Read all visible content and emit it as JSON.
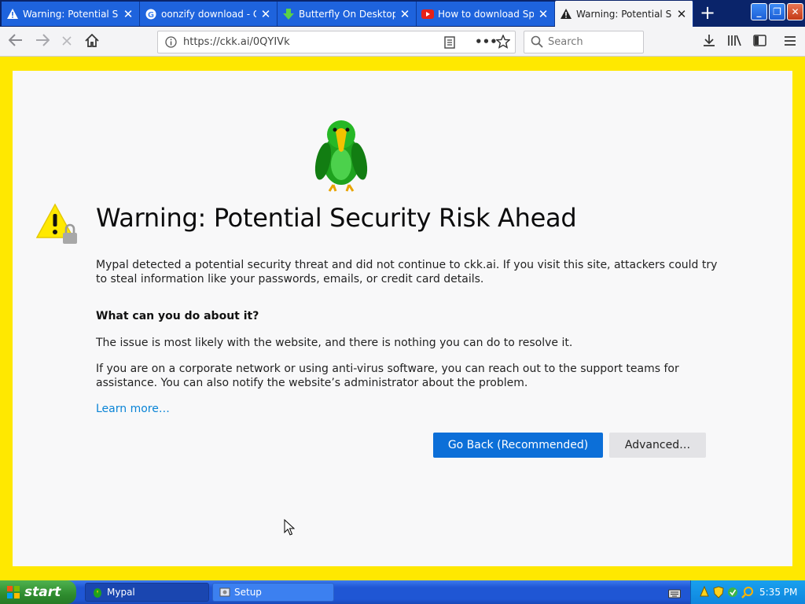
{
  "tabs": [
    {
      "title": "Warning: Potential Secu",
      "icon": "warning-icon",
      "active": false
    },
    {
      "title": "oonzify download - Goo",
      "icon": "google-icon",
      "active": false
    },
    {
      "title": "Butterfly On Desktop do",
      "icon": "download-icon",
      "active": false
    },
    {
      "title": "How to download SpySh",
      "icon": "youtube-icon",
      "active": false
    },
    {
      "title": "Warning: Potential Secu",
      "icon": "warning-icon",
      "active": true
    }
  ],
  "nav": {
    "url": "https://ckk.ai/0QYIVk",
    "search_placeholder": "Search"
  },
  "page": {
    "heading": "Warning: Potential Security Risk Ahead",
    "intro": "Mypal detected a potential security threat and did not continue to ckk.ai. If you visit this site, attackers could try to steal information like your passwords, emails, or credit card details.",
    "subheading": "What can you do about it?",
    "para1": "The issue is most likely with the website, and there is nothing you can do to resolve it.",
    "para2": "If you are on a corporate network or using anti-virus software, you can reach out to the support teams for assistance. You can also notify the website’s administrator about the problem.",
    "learn_more": "Learn more…",
    "go_back": "Go Back (Recommended)",
    "advanced": "Advanced…"
  },
  "taskbar": {
    "start": "start",
    "items": [
      {
        "label": "Mypal",
        "icon": "mypal-icon"
      },
      {
        "label": "Setup",
        "icon": "setup-icon"
      }
    ],
    "clock": "5:35 PM"
  },
  "colors": {
    "page_border": "#ffe800",
    "primary_button": "#0c6fd8",
    "link": "#0a84d6",
    "xp_taskbar": "#1f56d4",
    "xp_start": "#2e8c2e"
  }
}
